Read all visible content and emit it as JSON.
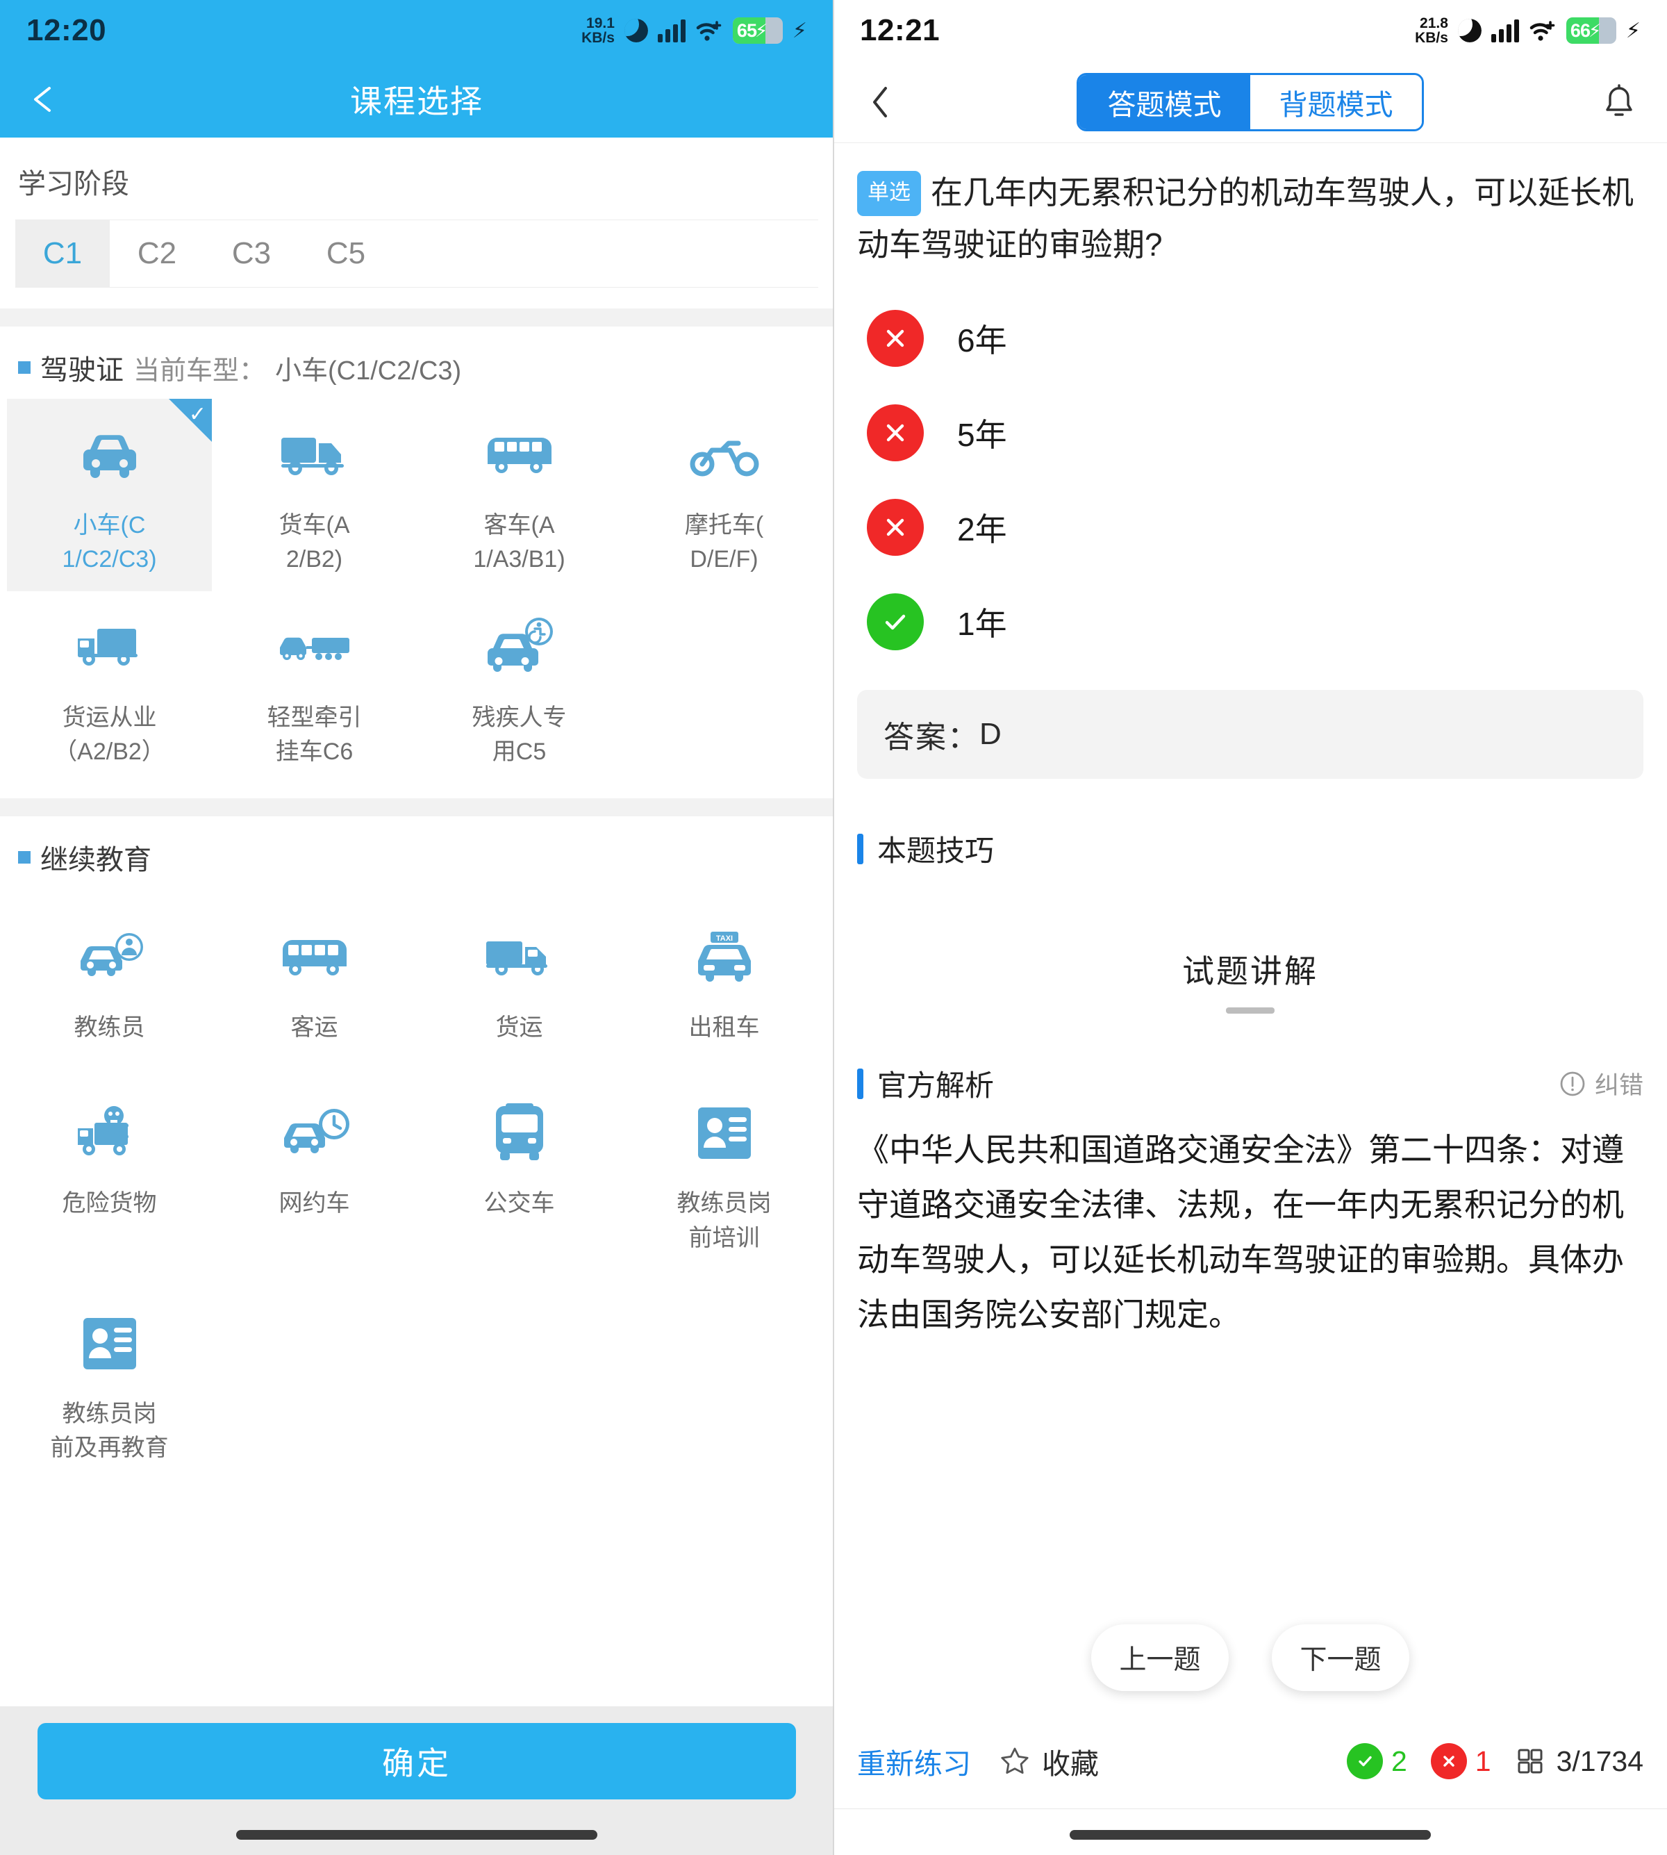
{
  "left": {
    "statusbar": {
      "time": "12:20",
      "netspeed_line1": "19.1",
      "netspeed_line2": "KB/s",
      "battery": "65",
      "battery_pct": 65
    },
    "appbar": {
      "title": "课程选择",
      "back_icon": "arrow-left-icon"
    },
    "stage": {
      "label": "学习阶段",
      "tabs": [
        {
          "label": "C1",
          "active": true
        },
        {
          "label": "C2",
          "active": false
        },
        {
          "label": "C3",
          "active": false
        },
        {
          "label": "C5",
          "active": false
        }
      ]
    },
    "license": {
      "title": "驾驶证",
      "current_label": "当前车型：",
      "current_value": "小车(C1/C2/C3)",
      "items": [
        {
          "label": "小车(C\n1/C2/C3)",
          "icon": "car-icon",
          "selected": true
        },
        {
          "label": "货车(A\n2/B2)",
          "icon": "truck-icon",
          "selected": false
        },
        {
          "label": "客车(A\n1/A3/B1)",
          "icon": "bus-icon",
          "selected": false
        },
        {
          "label": "摩托车(\nD/E/F)",
          "icon": "motorcycle-icon",
          "selected": false
        },
        {
          "label": "货运从业\n（A2/B2）",
          "icon": "cargo-truck-icon",
          "selected": false
        },
        {
          "label": "轻型牵引\n挂车C6",
          "icon": "car-trailer-icon",
          "selected": false
        },
        {
          "label": "残疾人专\n用C5",
          "icon": "disabled-car-icon",
          "selected": false
        }
      ]
    },
    "edu": {
      "title": "继续教育",
      "items": [
        {
          "label": "教练员",
          "icon": "instructor-car-icon"
        },
        {
          "label": "客运",
          "icon": "passenger-bus-icon"
        },
        {
          "label": "货运",
          "icon": "freight-truck-icon"
        },
        {
          "label": "出租车",
          "icon": "taxi-icon"
        },
        {
          "label": "危险货物",
          "icon": "hazmat-truck-icon"
        },
        {
          "label": "网约车",
          "icon": "ride-hailing-icon"
        },
        {
          "label": "公交车",
          "icon": "city-bus-icon"
        },
        {
          "label": "教练员岗\n前培训",
          "icon": "id-card-icon"
        },
        {
          "label": "教练员岗\n前及再教育",
          "icon": "id-card-icon"
        }
      ]
    },
    "confirm_button": "确定"
  },
  "right": {
    "statusbar": {
      "time": "12:21",
      "netspeed_line1": "21.8",
      "netspeed_line2": "KB/s",
      "battery": "66",
      "battery_pct": 66
    },
    "appbar": {
      "back_icon": "chevron-left-icon",
      "bell_icon": "bell-icon",
      "segments": [
        {
          "label": "答题模式",
          "active": true
        },
        {
          "label": "背题模式",
          "active": false
        }
      ]
    },
    "question": {
      "type_badge": "单选",
      "text": "在几年内无累积记分的机动车驾驶人，可以延长机动车驾驶证的审验期?",
      "options": [
        {
          "label": "6年",
          "state": "wrong"
        },
        {
          "label": "5年",
          "state": "wrong"
        },
        {
          "label": "2年",
          "state": "wrong"
        },
        {
          "label": "1年",
          "state": "right"
        }
      ],
      "answer_label": "答案：",
      "answer_value": "D"
    },
    "tips_section": {
      "title": "本题技巧",
      "content": ""
    },
    "explain_title": "试题讲解",
    "official": {
      "title": "官方解析",
      "report_label": "纠错",
      "report_icon": "exclamation-circle-icon",
      "body": "《中华人民共和国道路交通安全法》第二十四条：对遵守道路交通安全法律、法规，在一年内无累积记分的机动车驾驶人，可以延长机动车驾驶证的审验期。具体办法由国务院公安部门规定。"
    },
    "nav": {
      "prev": "上一题",
      "next": "下一题"
    },
    "toolbar": {
      "retry": "重新练习",
      "favorite": "收藏",
      "favorite_icon": "star-icon",
      "correct_count": "2",
      "wrong_count": "1",
      "grid_icon": "grid-icon",
      "progress": "3/1734"
    }
  },
  "colors": {
    "brand_blue": "#29b2ef",
    "seg_blue": "#1a84e8",
    "icon_blue": "#5aa9d6",
    "wrong_red": "#f02828",
    "right_green": "#27c322"
  }
}
